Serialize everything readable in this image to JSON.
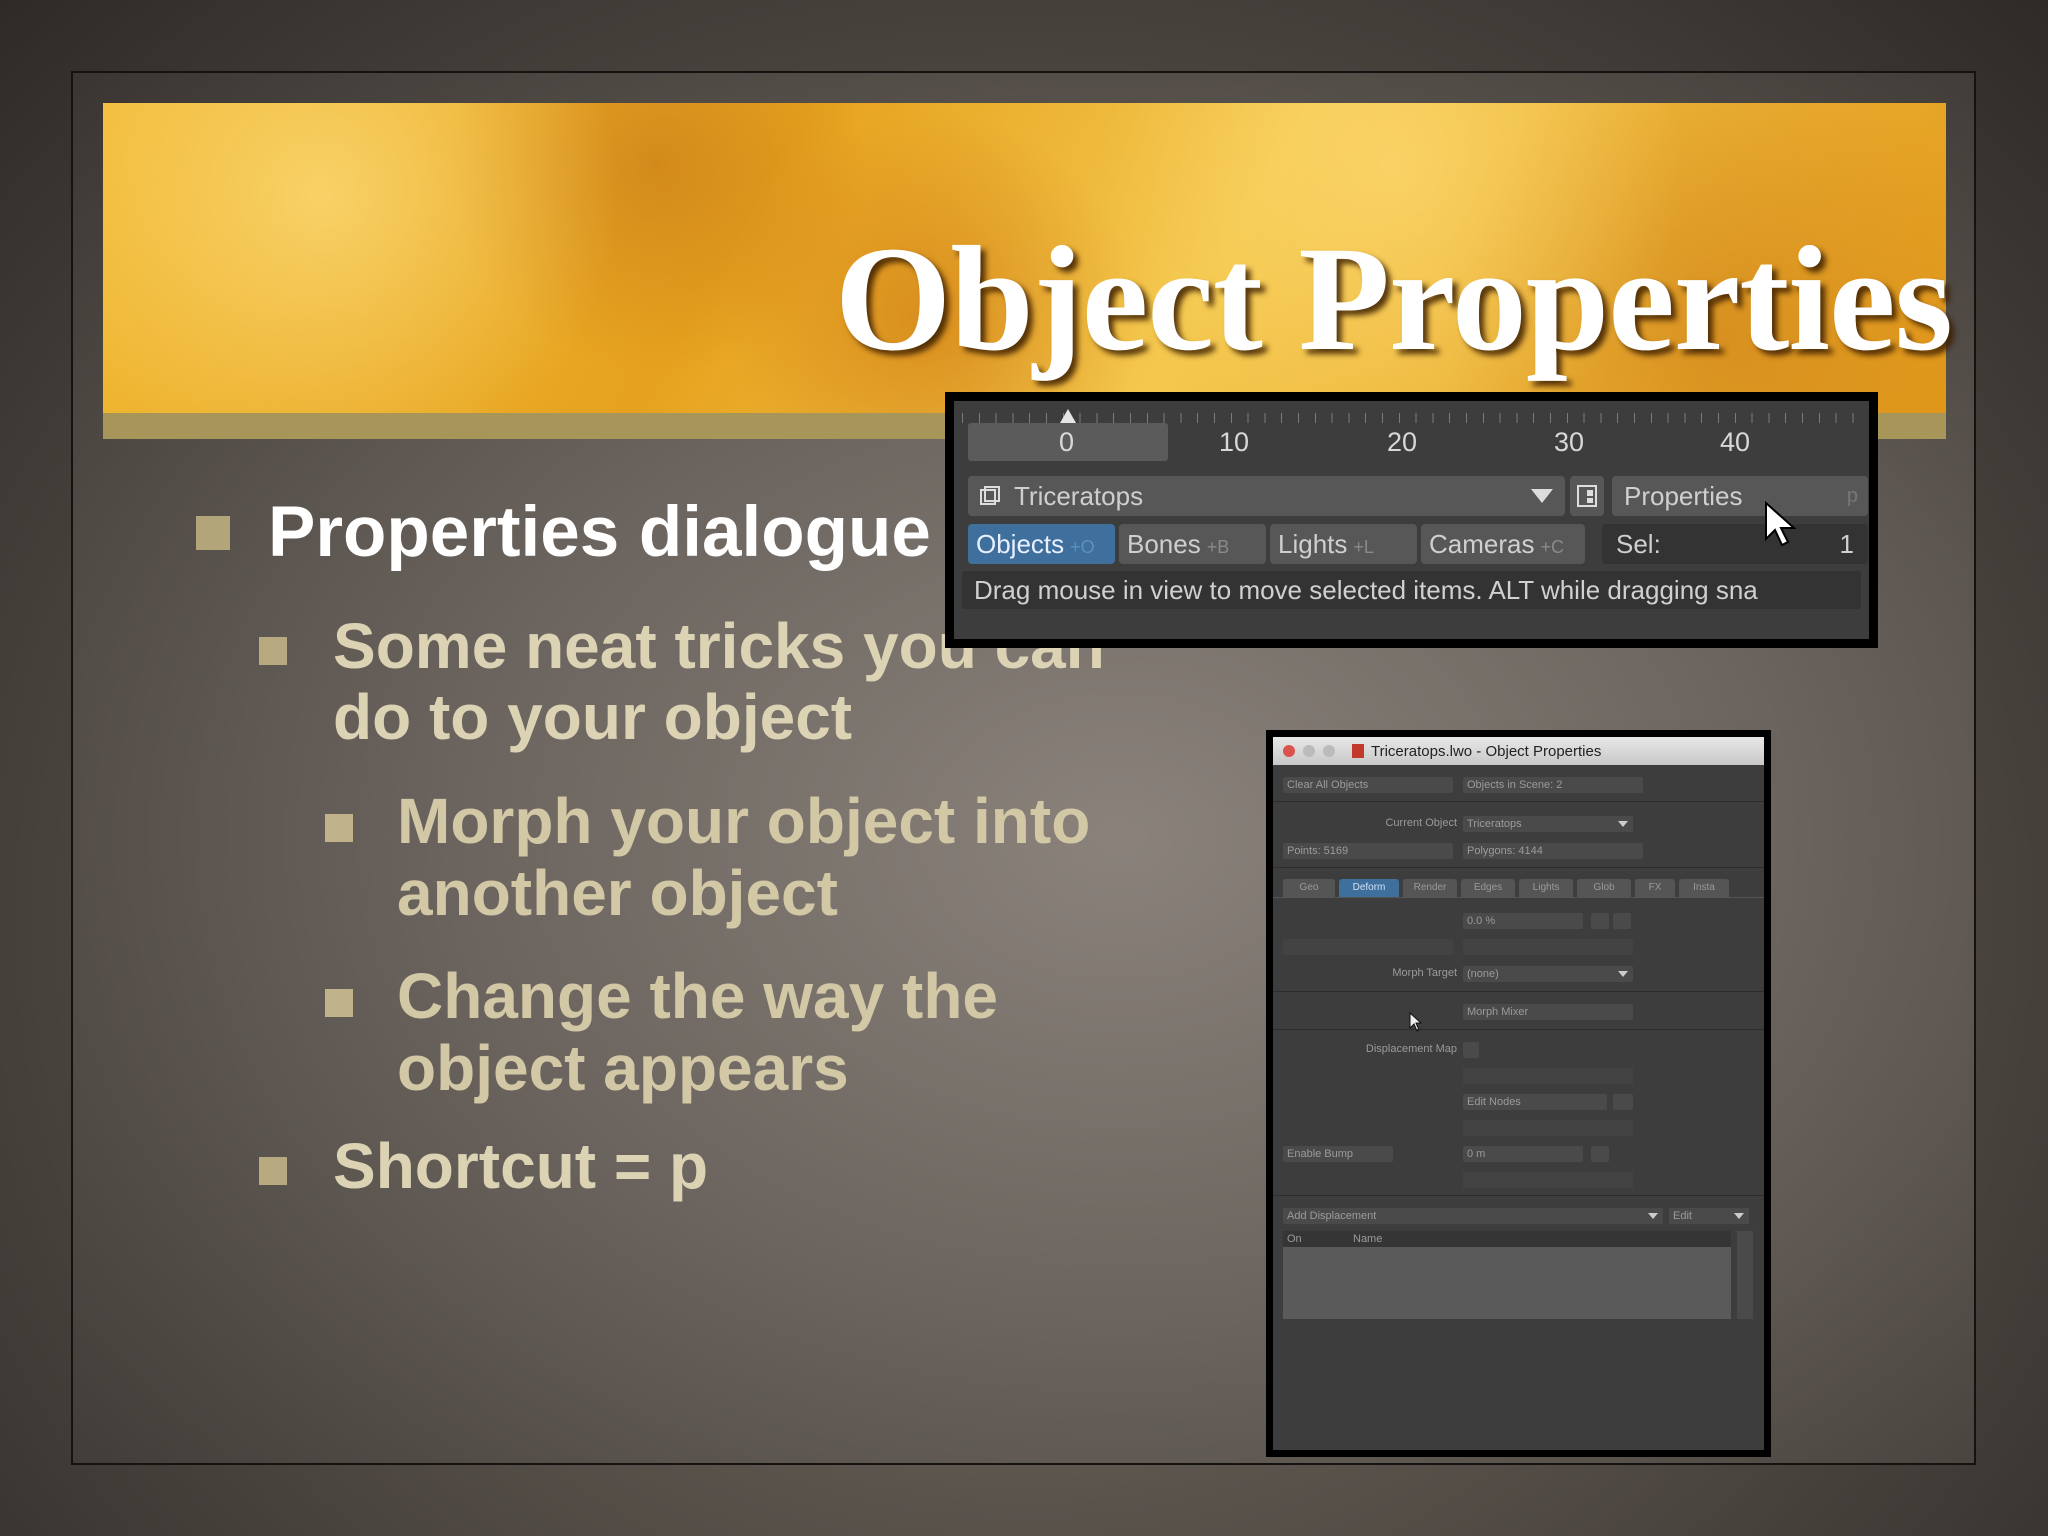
{
  "slide": {
    "title": "Object Properties",
    "bullets": [
      {
        "level": 1,
        "text": "Properties dialogue box"
      },
      {
        "level": 2,
        "text": "Some neat tricks you can do to your object"
      },
      {
        "level": 3,
        "text": "Morph your object into another object"
      },
      {
        "level": 3,
        "text": "Change the way the object appears"
      },
      {
        "level": 2,
        "text": "Shortcut = p"
      }
    ]
  },
  "timeline": {
    "ticks": [
      "0",
      "10",
      "20",
      "30",
      "40"
    ],
    "item_selector": "Triceratops",
    "properties_button": "Properties",
    "properties_shortcut": "p",
    "modes": [
      {
        "label": "Objects",
        "hint": "+O"
      },
      {
        "label": "Bones",
        "hint": "+B"
      },
      {
        "label": "Lights",
        "hint": "+L"
      },
      {
        "label": "Cameras",
        "hint": "+C"
      }
    ],
    "sel_label": "Sel:",
    "sel_value": "1",
    "status": "Drag mouse in view to move selected items. ALT while dragging sna"
  },
  "properties_window": {
    "title": "Triceratops.lwo - Object Properties",
    "clear_all": "Clear All Objects",
    "objects_in_scene": "Objects in Scene: 2",
    "current_object_label": "Current Object",
    "current_object": "Triceratops",
    "points": "Points: 5169",
    "polygons": "Polygons: 4144",
    "tabs": [
      "Geo",
      "Deform",
      "Render",
      "Edges",
      "Lights",
      "Glob",
      "FX",
      "Insta"
    ],
    "morph_amount_value": "0.0 %",
    "morph_target_label": "Morph Target",
    "morph_target": "(none)",
    "morph_mixer": "Morph Mixer",
    "displacement_map_label": "Displacement Map",
    "edit_nodes": "Edit Nodes",
    "enable_bump": "Enable Bump",
    "bump_value": "0 m",
    "add_displacement": "Add Displacement",
    "edit": "Edit",
    "col_on": "On",
    "col_name": "Name"
  }
}
